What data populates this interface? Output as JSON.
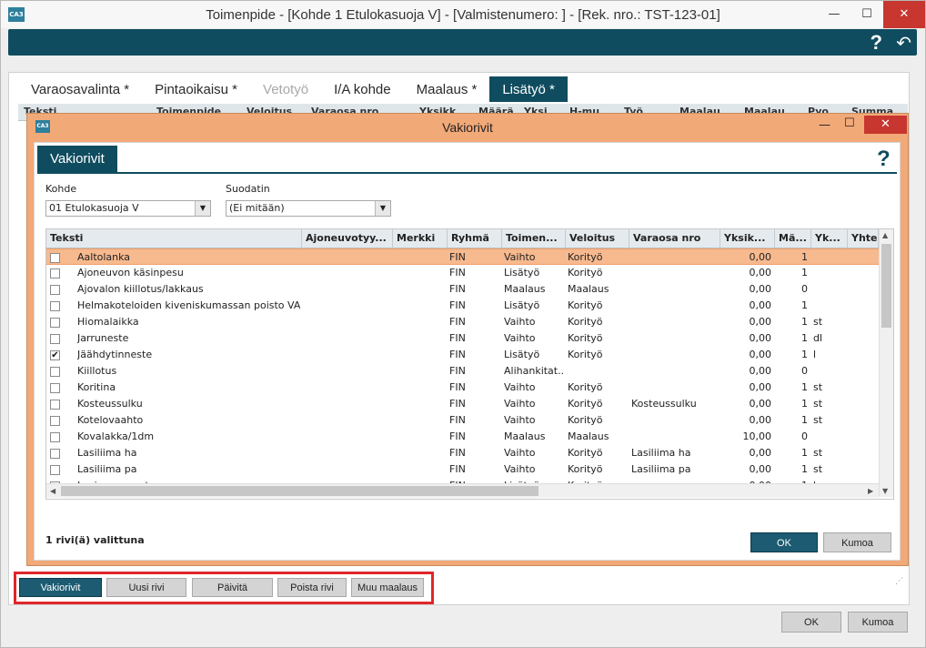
{
  "window": {
    "title": "Toimenpide - [Kohde 1 Etulokasuoja V] - [Valmistenumero: ] - [Rek. nro.: TST-123-01]",
    "app_icon": "CA3",
    "minimize": "—",
    "maximize": "☐",
    "close": "✕"
  },
  "header": {
    "help": "?",
    "back": "↶"
  },
  "tabs": [
    {
      "label": "Varaosavalinta *"
    },
    {
      "label": "Pintaoikaisu *"
    },
    {
      "label": "Vetotyö"
    },
    {
      "label": "I/A kohde"
    },
    {
      "label": "Maalaus *"
    },
    {
      "label": "Lisätyö *"
    }
  ],
  "background_grid_headers": [
    "Teksti",
    "Toimenpide",
    "Veloitus",
    "Varaosa nro",
    "Yksikk.",
    "Määrä",
    "Yksi.",
    "H-mu.",
    "Työ",
    "Maalau.",
    "Maalau.",
    "Pyo.",
    "Summa"
  ],
  "bottom_actions": {
    "vakiorivit": "Vakiorivit",
    "uusi_rivi": "Uusi rivi",
    "paivita": "Päivitä",
    "poista_rivi": "Poista rivi",
    "muu_maalaus": "Muu maalaus"
  },
  "main_buttons": {
    "ok": "OK",
    "cancel": "Kumoa"
  },
  "dialog": {
    "title": "Vakiorivit",
    "icon": "CA3",
    "tab": "Vakiorivit",
    "help": "?",
    "minimize": "—",
    "maximize": "☐",
    "close": "✕",
    "kohde": {
      "label": "Kohde",
      "value": "01 Etulokasuoja V"
    },
    "suodatin": {
      "label": "Suodatin",
      "value": "(Ei mitään)"
    },
    "status": "1 rivi(ä) valittuna",
    "ok": "OK",
    "cancel": "Kumoa",
    "columns": [
      "Teksti",
      "Ajoneuvotyy...",
      "Merkki",
      "Ryhmä",
      "Toimen...",
      "Veloitus",
      "Varaosa nro",
      "Yksik...",
      "Mä...",
      "Yk...",
      "Yhte"
    ],
    "rows": [
      {
        "checked": false,
        "selected": true,
        "teksti": "Aaltolanka",
        "ryhma": "FIN",
        "toimen": "Vaihto",
        "veloitus": "Korityö",
        "varaosa": "",
        "yksik": "0,00",
        "maara": "1",
        "yk": ""
      },
      {
        "checked": false,
        "selected": false,
        "teksti": "Ajoneuvon käsinpesu",
        "ryhma": "FIN",
        "toimen": "Lisätyö",
        "veloitus": "Korityö",
        "varaosa": "",
        "yksik": "0,00",
        "maara": "1",
        "yk": ""
      },
      {
        "checked": false,
        "selected": false,
        "teksti": "Ajovalon kiillotus/lakkaus",
        "ryhma": "FIN",
        "toimen": "Maalaus",
        "veloitus": "Maalaus",
        "varaosa": "",
        "yksik": "0,00",
        "maara": "0",
        "yk": ""
      },
      {
        "checked": false,
        "selected": false,
        "teksti": "Helmakoteloiden kiveniskumassan poisto VAG",
        "ryhma": "FIN",
        "toimen": "Lisätyö",
        "veloitus": "Korityö",
        "varaosa": "",
        "yksik": "0,00",
        "maara": "1",
        "yk": ""
      },
      {
        "checked": false,
        "selected": false,
        "teksti": "Hiomalaikka",
        "ryhma": "FIN",
        "toimen": "Vaihto",
        "veloitus": "Korityö",
        "varaosa": "",
        "yksik": "0,00",
        "maara": "1",
        "yk": "st"
      },
      {
        "checked": false,
        "selected": false,
        "teksti": "Jarruneste",
        "ryhma": "FIN",
        "toimen": "Vaihto",
        "veloitus": "Korityö",
        "varaosa": "",
        "yksik": "0,00",
        "maara": "1",
        "yk": "dl"
      },
      {
        "checked": true,
        "selected": false,
        "teksti": "Jäähdytinneste",
        "ryhma": "FIN",
        "toimen": "Lisätyö",
        "veloitus": "Korityö",
        "varaosa": "",
        "yksik": "0,00",
        "maara": "1",
        "yk": "l"
      },
      {
        "checked": false,
        "selected": false,
        "teksti": "Kiillotus",
        "ryhma": "FIN",
        "toimen": "Alihankitat...",
        "veloitus": "",
        "varaosa": "",
        "yksik": "0,00",
        "maara": "0",
        "yk": ""
      },
      {
        "checked": false,
        "selected": false,
        "teksti": "Koritina",
        "ryhma": "FIN",
        "toimen": "Vaihto",
        "veloitus": "Korityö",
        "varaosa": "",
        "yksik": "0,00",
        "maara": "1",
        "yk": "st"
      },
      {
        "checked": false,
        "selected": false,
        "teksti": "Kosteussulku",
        "ryhma": "FIN",
        "toimen": "Vaihto",
        "veloitus": "Korityö",
        "varaosa": "Kosteussulku",
        "yksik": "0,00",
        "maara": "1",
        "yk": "st"
      },
      {
        "checked": false,
        "selected": false,
        "teksti": "Kotelovaahto",
        "ryhma": "FIN",
        "toimen": "Vaihto",
        "veloitus": "Korityö",
        "varaosa": "",
        "yksik": "0,00",
        "maara": "1",
        "yk": "st"
      },
      {
        "checked": false,
        "selected": false,
        "teksti": "Kovalakka/1dm",
        "ryhma": "FIN",
        "toimen": "Maalaus",
        "veloitus": "Maalaus",
        "varaosa": "",
        "yksik": "10,00",
        "maara": "0",
        "yk": ""
      },
      {
        "checked": false,
        "selected": false,
        "teksti": "Lasiliima ha",
        "ryhma": "FIN",
        "toimen": "Vaihto",
        "veloitus": "Korityö",
        "varaosa": "Lasiliima ha",
        "yksik": "0,00",
        "maara": "1",
        "yk": "st"
      },
      {
        "checked": false,
        "selected": false,
        "teksti": "Lasiliima pa",
        "ryhma": "FIN",
        "toimen": "Vaihto",
        "veloitus": "Korityö",
        "varaosa": "Lasiliima pa",
        "yksik": "0,00",
        "maara": "1",
        "yk": "st"
      },
      {
        "checked": false,
        "selected": false,
        "teksti": "Lasinpesuneste",
        "ryhma": "FIN",
        "toimen": "Lisätyö",
        "veloitus": "Korityö",
        "varaosa": "",
        "yksik": "0,00",
        "maara": "1",
        "yk": "l"
      }
    ]
  },
  "colors": {
    "accent": "#0f4c5f",
    "dialog_frame": "#f2a978",
    "selected_row": "#f7b98e",
    "highlight_box": "#e0262b"
  }
}
